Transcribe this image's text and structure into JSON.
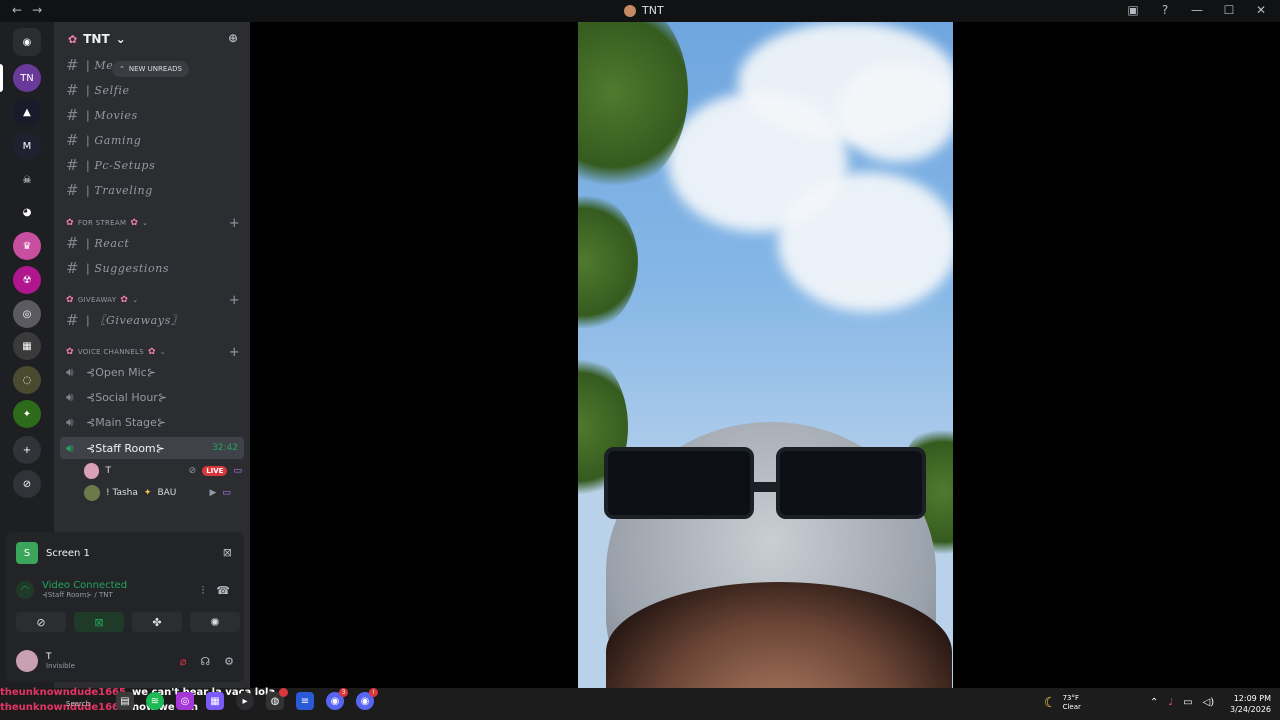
{
  "window": {
    "title": "TNT",
    "nav_back": "←",
    "nav_forward": "→",
    "controls": [
      "▣",
      "?",
      "—",
      "☐",
      "✕"
    ]
  },
  "server_rail": {
    "items": [
      {
        "label": "",
        "color": "#2b2d31",
        "glyph": "◉"
      },
      {
        "label": "TNT",
        "color": "#6a3a9a",
        "glyph": "TN"
      },
      {
        "label": "",
        "color": "#1a1a2a",
        "glyph": "▲"
      },
      {
        "label": "",
        "color": "#202030",
        "glyph": "M"
      },
      {
        "label": "",
        "color": "#1e1f22",
        "glyph": "☠"
      },
      {
        "label": "",
        "color": "#1e1f22",
        "glyph": "◕"
      },
      {
        "label": "",
        "color": "#c84fa0",
        "glyph": "♛"
      },
      {
        "label": "",
        "color": "#b0168d",
        "glyph": "☢"
      },
      {
        "label": "",
        "color": "#5a5a60",
        "glyph": "◎"
      },
      {
        "label": "",
        "color": "#3a3a3a",
        "glyph": "▦"
      },
      {
        "label": "",
        "color": "#4a4a30",
        "glyph": "◌"
      },
      {
        "label": "",
        "color": "#2d6a1a",
        "glyph": "✦"
      },
      {
        "label": "",
        "color": "#313338",
        "glyph": "+"
      },
      {
        "label": "",
        "color": "#313338",
        "glyph": "⊘"
      }
    ]
  },
  "sidebar": {
    "server_name": "TNT",
    "new_unreads": "NEW UNREADS",
    "channels_top": [
      "| Me",
      "| Selfie",
      "| Movies",
      "| Gaming",
      "| Pc-Setups",
      "| Traveling"
    ],
    "cat_stream": "FOR STREAM",
    "channels_stream": [
      "| React",
      "| Suggestions"
    ],
    "cat_giveaway": "GIVEAWAY",
    "channels_giveaway": [
      "| 〖Giveaways〗"
    ],
    "cat_voice": "VOICE CHANNELS",
    "voice_channels": [
      "⊰Open Mic⊱",
      "⊰Social Hour⊱",
      "⊰Main Stage⊱",
      "⊰Staff Room⊱"
    ],
    "active_timer": "32:42",
    "members": [
      {
        "name": "T",
        "live": "LIVE"
      },
      {
        "name": "! Tasha",
        "tag": "BAU"
      }
    ]
  },
  "panel": {
    "screen_label": "Screen 1",
    "status": "Video Connected",
    "location": "⊰Staff Room⊱ / TNT",
    "user_name": "T",
    "user_status": "Invisible"
  },
  "chat_overlay": [
    {
      "who": "theunknowndude1665",
      "msg": "we can't hear la vaca lola"
    },
    {
      "who": "theunknowndude1665",
      "msg": "now we can"
    }
  ],
  "taskbar": {
    "search": "Search",
    "weather_temp": "73°F",
    "weather_desc": "Clear",
    "time": "12:09 PM",
    "date": "3/24/2026",
    "badges": [
      "3",
      "!"
    ]
  },
  "colors": {
    "accent_green": "#23a55a",
    "live_red": "#da373c",
    "flower_pink": "#f47fb1"
  }
}
